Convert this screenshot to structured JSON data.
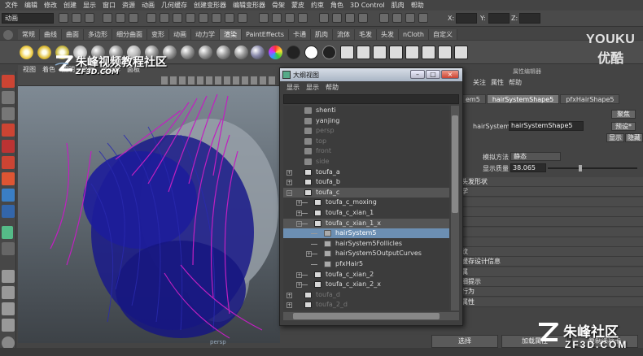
{
  "menubar": [
    "文件",
    "编辑",
    "修改",
    "创建",
    "显示",
    "窗口",
    "资源",
    "动画",
    "几何缓存",
    "创建变形器",
    "编辑变形器",
    "骨架",
    "蒙皮",
    "约束",
    "角色",
    "3D Control",
    "肌肉",
    "帮助"
  ],
  "status_line": {
    "mode": "动画",
    "x_label": "X:",
    "y_label": "Y:",
    "z_label": "Z:"
  },
  "shelf_tabs": [
    "常规",
    "曲线",
    "曲面",
    "多边形",
    "细分曲面",
    "变形",
    "动画",
    "动力学",
    "渲染",
    "PaintEffects",
    "卡通",
    "肌肉",
    "流体",
    "毛发",
    "头发",
    "nCloth",
    "自定义"
  ],
  "shelf_active_tab": "渲染",
  "viewport": {
    "menu": [
      "视图",
      "着色",
      "照明",
      "显示",
      "渲染器",
      "面板"
    ],
    "camera_label": "persp"
  },
  "watermark": {
    "title": "朱峰视频教程社区",
    "site": "ZF3D.COM",
    "brand_en": "YOUKU",
    "brand_zh": "优酷",
    "corner_title": "朱峰社区",
    "corner_site": "ZF3D.COM"
  },
  "outliner": {
    "title": "大纲视图",
    "menu": [
      "显示",
      "显示",
      "帮助"
    ],
    "items": [
      {
        "label": "shenti",
        "icon": "camera-icon",
        "indent": 0,
        "state": "normal",
        "expander": ""
      },
      {
        "label": "yanjing",
        "icon": "camera-icon",
        "indent": 0,
        "state": "normal",
        "expander": ""
      },
      {
        "label": "persp",
        "icon": "camera-icon",
        "indent": 0,
        "state": "dim",
        "expander": ""
      },
      {
        "label": "top",
        "icon": "camera-icon",
        "indent": 0,
        "state": "dim",
        "expander": ""
      },
      {
        "label": "front",
        "icon": "camera-icon",
        "indent": 0,
        "state": "dim",
        "expander": ""
      },
      {
        "label": "side",
        "icon": "camera-icon",
        "indent": 0,
        "state": "dim",
        "expander": ""
      },
      {
        "label": "toufa_a",
        "icon": "hair-icon",
        "indent": 0,
        "state": "normal",
        "expander": "+"
      },
      {
        "label": "toufa_b",
        "icon": "hair-icon",
        "indent": 0,
        "state": "normal",
        "expander": "+"
      },
      {
        "label": "toufa_c",
        "icon": "hair-icon",
        "indent": 0,
        "state": "highlight",
        "expander": "−"
      },
      {
        "label": "toufa_c_moxing",
        "icon": "hair-icon",
        "indent": 1,
        "state": "normal",
        "expander": "+"
      },
      {
        "label": "toufa_c_xian_1",
        "icon": "hair-icon",
        "indent": 1,
        "state": "normal",
        "expander": "+"
      },
      {
        "label": "toufa_c_xian_1_x",
        "icon": "hair-icon",
        "indent": 1,
        "state": "highlight",
        "expander": "−"
      },
      {
        "label": "hairSystem5",
        "icon": "hairsystem-icon",
        "indent": 2,
        "state": "selected",
        "expander": ""
      },
      {
        "label": "hairSystem5Follicles",
        "icon": "hairsystem-icon",
        "indent": 2,
        "state": "normal",
        "expander": ""
      },
      {
        "label": "hairSystem5OutputCurves",
        "icon": "hairsystem-icon",
        "indent": 2,
        "state": "normal",
        "expander": "+"
      },
      {
        "label": "pfxHair5",
        "icon": "hairsystem-icon",
        "indent": 2,
        "state": "normal",
        "expander": ""
      },
      {
        "label": "toufa_c_xian_2",
        "icon": "hair-icon",
        "indent": 1,
        "state": "normal",
        "expander": "+"
      },
      {
        "label": "toufa_c_xian_2_x",
        "icon": "hair-icon",
        "indent": 1,
        "state": "normal",
        "expander": "+"
      },
      {
        "label": "toufa_d",
        "icon": "hair-icon",
        "indent": 0,
        "state": "dim",
        "expander": "+"
      },
      {
        "label": "toufa_2_d",
        "icon": "hair-icon",
        "indent": 0,
        "state": "dim",
        "expander": "+"
      }
    ]
  },
  "attribute_editor": {
    "title": "属性编辑器",
    "menu": [
      "关注",
      "属性",
      "帮助"
    ],
    "tabs": [
      "em5",
      "hairSystemShape5",
      "pfxHairShape5"
    ],
    "active_tab": "hairSystemShape5",
    "node_label": "hairSystem:",
    "node_value": "hairSystemShape5",
    "buttons": {
      "focus": "聚焦",
      "presets": "预设*",
      "show": "显示",
      "hide": "隐藏"
    },
    "sim_method_label": "模拟方法",
    "sim_method_value": "静态",
    "quality_label": "显示质量",
    "quality_value": "38.065",
    "sections": [
      "头发形状",
      "学",
      "",
      "",
      "",
      "",
      "",
      "纹",
      "缓存设计信息",
      "属",
      "细提示",
      "行为",
      "属性"
    ],
    "bottom_buttons": [
      "选择",
      "加载属性",
      "复制选项卡"
    ]
  },
  "accent_colors": {
    "selected_row": "#6c8fb3",
    "hair_magenta": "#c020c0",
    "hair_blue": "#2a2ab0"
  }
}
